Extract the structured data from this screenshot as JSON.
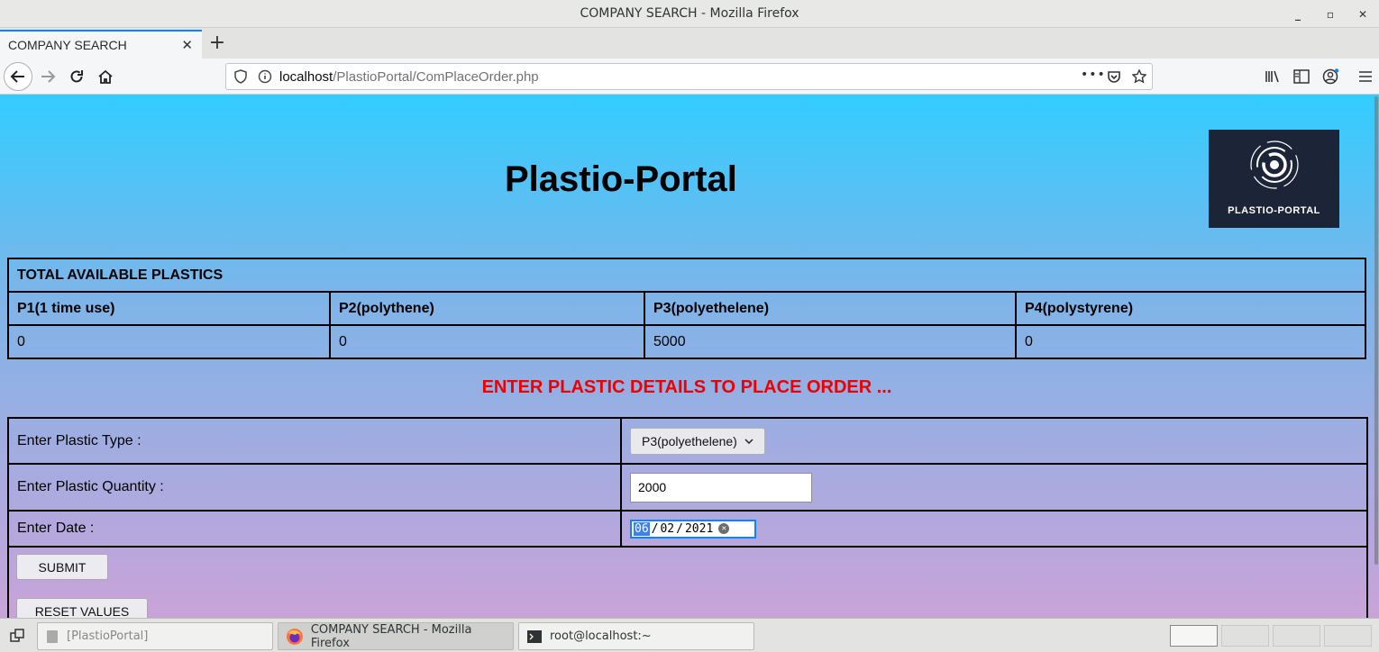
{
  "window": {
    "title": "COMPANY SEARCH - Mozilla Firefox",
    "controls": {
      "minimize": "_",
      "maximize": "▫",
      "close": "✕"
    }
  },
  "browser": {
    "tab_label": "COMPANY SEARCH",
    "tab_close": "✕",
    "new_tab": "+",
    "url_host": "localhost",
    "url_path": "/PlastioPortal/ComPlaceOrder.php",
    "page_actions": "•••"
  },
  "page": {
    "brand": "Plastio-Portal",
    "logo_text": "PLASTIO-PORTAL",
    "available": {
      "heading": "TOTAL AVAILABLE PLASTICS",
      "columns": [
        "P1(1 time use)",
        "P2(polythene)",
        "P3(polyethelene)",
        "P4(polystyrene)"
      ],
      "values": [
        "0",
        "0",
        "5000",
        "0"
      ]
    },
    "order_heading": "ENTER PLASTIC DETAILS TO PLACE ORDER ...",
    "form": {
      "type_label": "Enter Plastic Type :",
      "type_value": "P3(polyethelene)",
      "quantity_label": "Enter Plastic Quantity :",
      "quantity_value": "2000",
      "date_label": "Enter Date :",
      "date_month": "06",
      "date_day": "02",
      "date_year": "2021",
      "submit_label": "SUBMIT",
      "reset_label": "RESET VALUES"
    }
  },
  "taskbar": {
    "items": [
      "[PlastioPortal]",
      "COMPANY SEARCH - Mozilla Firefox",
      "root@localhost:~"
    ]
  },
  "colors": {
    "accent": "#0a84ff",
    "heading_red": "#ee0000",
    "logo_bg": "#1c2438"
  }
}
